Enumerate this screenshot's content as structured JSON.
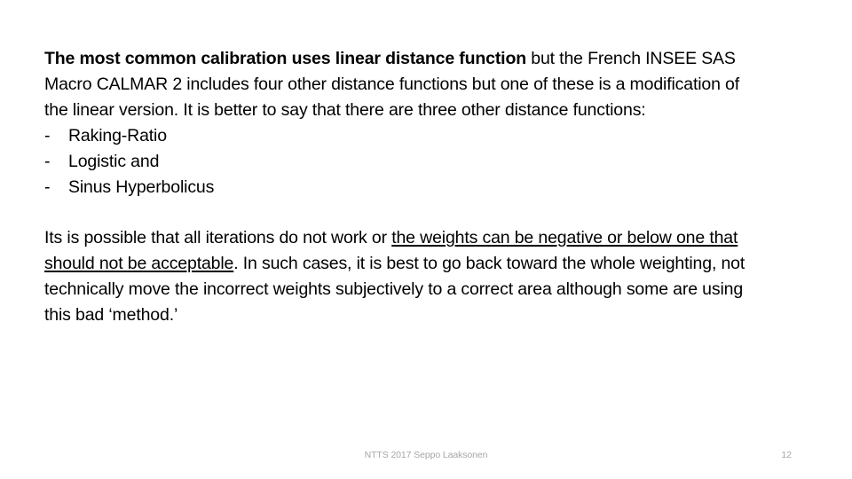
{
  "slide": {
    "paragraph1": {
      "lead_bold": "The most common calibration uses linear distance function",
      "rest": " but the French INSEE SAS Macro CALMAR 2 includes four other distance functions but one of these is a modification of the linear version. It is better to say that there are three other distance functions:"
    },
    "list": {
      "marker": "-",
      "items": [
        "Raking-Ratio",
        "Logistic and",
        "Sinus Hyperbolicus"
      ]
    },
    "paragraph2": {
      "before_underline": "Its is possible that all iterations do not work or ",
      "underlined": "the weights can be negative or below one that should not be acceptable",
      "after_underline": ". In such cases, it is best to go back toward the whole weighting, not technically move the incorrect weights subjectively to a correct area although some are using this bad ‘method.’"
    },
    "footer": {
      "note": "NTTS 2017 Seppo Laaksonen",
      "page_number": "12"
    },
    "colors": {
      "text": "#000000",
      "footer_text": "#a6a6a6",
      "background": "#ffffff"
    }
  }
}
